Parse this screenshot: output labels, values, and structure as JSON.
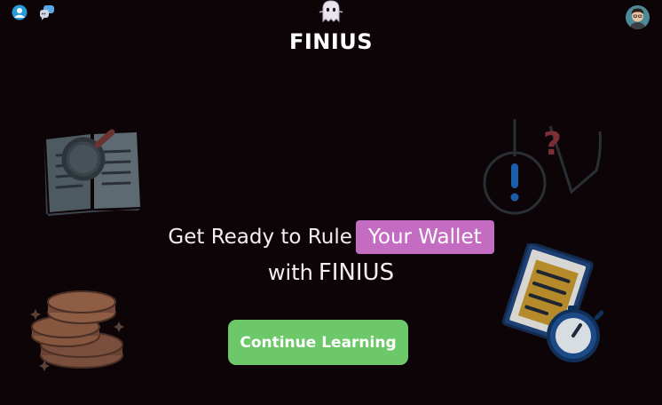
{
  "header": {
    "brand": "FINIUS",
    "icons": [
      "profile-icon",
      "chat-icon",
      "ghost-logo-icon",
      "avatar"
    ]
  },
  "hero": {
    "headline_prefix": "Get Ready to Rule",
    "headline_highlight": "Your Wallet",
    "headline_with": "with",
    "headline_brand": "FINIUS"
  },
  "cta": {
    "label": "Continue Learning"
  },
  "decor": {
    "icons": [
      "book-magnifier-icon",
      "question-exclamation-icon",
      "coins-stack-icon",
      "document-stopwatch-icon"
    ]
  },
  "colors": {
    "background": "#0d0408",
    "highlight": "#c46bc2",
    "cta": "#6dc869"
  }
}
